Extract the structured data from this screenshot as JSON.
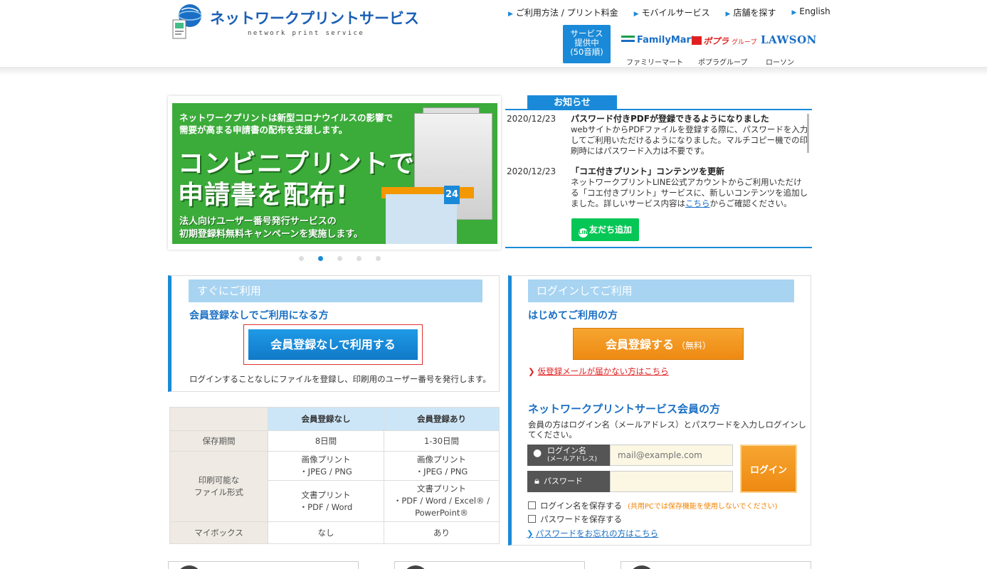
{
  "header": {
    "logo_title": "ネットワークプリントサービス",
    "logo_sub": "network print service",
    "links": [
      "ご利用方法 / プリント料金",
      "モバイルサービス",
      "店舗を探す",
      "English"
    ],
    "service_badge": [
      "サービス",
      "提供中",
      "(50音順)"
    ],
    "stores": [
      {
        "name": "FamilyMart",
        "sub": "ファミリーマート",
        "color": "#1a6fc4"
      },
      {
        "name": "ポプラ",
        "extra": "グループ",
        "sub": "ポプラグループ",
        "color": "#e02020"
      },
      {
        "name": "LAWSON",
        "sub": "ローソン",
        "color": "#1a6fc4"
      }
    ]
  },
  "slider": {
    "top_text": [
      "ネットワークプリントは新型コロナウイルスの影響で",
      "需要が高まる申請書の配布を支援します。"
    ],
    "big1": "コンビニプリントで",
    "big2": "申請書を配布!",
    "bottom_text": [
      "法人向けユーザー番号発行サービスの",
      "初期登録料無料キャンペーンを実施します。"
    ],
    "store_sign": "24",
    "active_dot": 1,
    "dot_count": 5
  },
  "news": {
    "tab": "お知らせ",
    "items": [
      {
        "date": "2020/12/23",
        "title": "パスワード付きPDFが登録できるようになりました",
        "body": "webサイトからPDFファイルを登録する際に、パスワードを入力してご利用いただけるようになりました。マルチコピー機での印刷時にはパスワード入力は不要です。"
      },
      {
        "date": "2020/12/23",
        "title": "「コエ付きプリント」コンテンツを更新",
        "body_before": "ネットワークプリントLINE公式アカウントからご利用いただける「コエ付きプリント」サービスに、新しいコンテンツを追加しました。詳しいサービス内容は",
        "body_link": "こちら",
        "body_after": "からご確認ください。"
      }
    ],
    "line_button": "友だち追加",
    "line_icon": "LINE"
  },
  "quick": {
    "head": "すぐにご利用",
    "sub": "会員登録なしでご利用になる方",
    "button": "会員登録なしで利用する",
    "note": "ログインすることなしにファイルを登録し、印刷用のユーザー番号を発行します。"
  },
  "compare": {
    "headers": [
      "会員登録なし",
      "会員登録あり"
    ],
    "rows": {
      "retention": {
        "label": "保存期間",
        "a": "8日間",
        "b": "1-30日間"
      },
      "formats_label": [
        "印刷可能な",
        "ファイル形式"
      ],
      "image": {
        "a1": "画像プリント",
        "a2": "・JPEG / PNG",
        "b1": "画像プリント",
        "b2": "・JPEG / PNG"
      },
      "doc": {
        "a1": "文書プリント",
        "a2": "・PDF / Word",
        "b1": "文書プリント",
        "b2": "・PDF / Word / Excel® /",
        "b3": "PowerPoint®"
      },
      "mybox": {
        "label": "マイボックス",
        "a": "なし",
        "b": "あり"
      }
    }
  },
  "login": {
    "head": "ログインしてご利用",
    "first_title": "はじめてご利用の方",
    "register_button": "会員登録する",
    "register_free": "（無料）",
    "mail_link": "仮登録メールが届かない方はこちら",
    "member_title": "ネットワークプリントサービス会員の方",
    "member_desc": "会員の方はログイン名（メールアドレス）とパスワードを入力しログインしてください。",
    "login_label": "ログイン名",
    "login_label_sub": "(メールアドレス)",
    "login_placeholder": "mail@example.com",
    "password_label": "パスワード",
    "login_button": "ログイン",
    "save_login": "ログイン名を保存する",
    "save_login_warn": "(共用PCでは保存機能を使用しないでください)",
    "save_password": "パスワードを保存する",
    "forgot_link": "パスワードをお忘れの方はこちら"
  },
  "colors": {
    "accent": "#1a8ad8",
    "orange": "#f39800",
    "line_green": "#06c755",
    "slide_green": "#3bab3a"
  }
}
